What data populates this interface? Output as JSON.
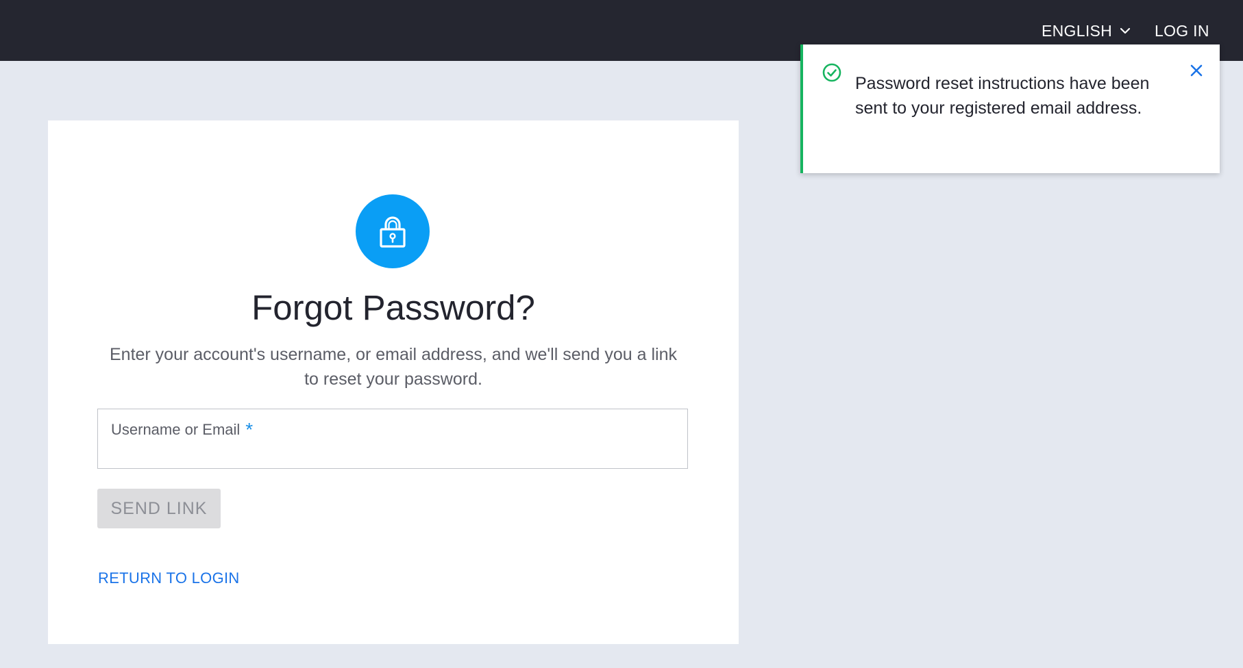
{
  "header": {
    "language_label": "ENGLISH",
    "login_label": "LOG IN"
  },
  "form": {
    "title": "Forgot Password?",
    "description": "Enter your account's username, or email address, and we'll send you a link to reset your password.",
    "field_label": "Username or Email",
    "required_marker": "*",
    "field_value": "",
    "send_button_label": "SEND LINK",
    "return_link_label": "RETURN TO LOGIN"
  },
  "toast": {
    "message": "Password reset instructions have been sent to your registered email address.",
    "status": "success"
  },
  "icons": {
    "lock": "lock-icon",
    "check": "check-circle-icon",
    "close": "close-icon",
    "chevron": "chevron-down-icon"
  },
  "colors": {
    "topbar": "#252630",
    "background": "#e4e8f0",
    "accent": "#0a9ef5",
    "link": "#1a73e8",
    "success": "#16b45f"
  }
}
